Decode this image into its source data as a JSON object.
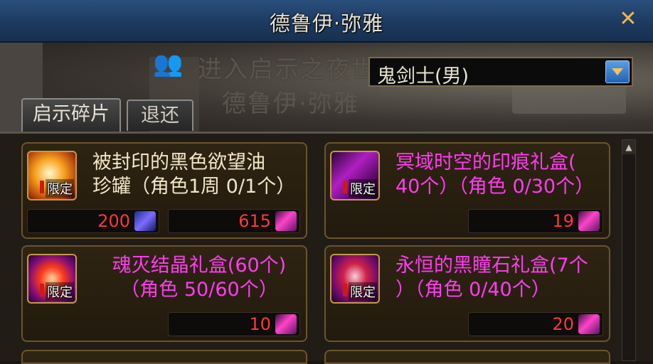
{
  "window": {
    "title": "德鲁伊·弥雅"
  },
  "banner": {
    "title": "进入启示之夜世界",
    "subtitle": "德鲁伊·弥雅"
  },
  "class_select": {
    "value": "鬼剑士(男)"
  },
  "tabs": [
    {
      "label": "启示碎片",
      "active": true
    },
    {
      "label": "退还",
      "active": false
    }
  ],
  "items": [
    {
      "name": "被封印的黑色欲望油珍罐（角色1周 0/1个）",
      "name_lines": [
        "被封印的黑色欲望油",
        "珍罐（角色1周 0/1个）"
      ],
      "color": "#f1e6c8",
      "badge": "限定",
      "prices": [
        {
          "value": "200",
          "currency": "blue-crystal-icon"
        },
        {
          "value": "615",
          "currency": "pink-crystal-icon"
        }
      ]
    },
    {
      "name": "冥域时空的印痕礼盒(40个)（角色 0/30个）",
      "name_lines": [
        "冥域时空的印痕礼盒(",
        "40个）（角色 0/30个）"
      ],
      "color": "#ff3cf0",
      "badge": "限定",
      "prices": [
        {
          "value": "19",
          "currency": "pink-crystal-icon"
        }
      ]
    },
    {
      "name": "魂灭结晶礼盒(60个)（角色 50/60个）",
      "name_lines": [
        "魂灭结晶礼盒(60个)",
        "（角色 50/60个）"
      ],
      "color": "#ff3cf0",
      "badge": "限定",
      "prices": [
        {
          "value": "10",
          "currency": "pink-crystal-icon"
        }
      ]
    },
    {
      "name": "永恒的黑瞳石礼盒(7个)（角色 0/40个）",
      "name_lines": [
        "永恒的黑瞳石礼盒(7个",
        "）（角色 0/40个）"
      ],
      "color": "#ff3cf0",
      "badge": "限定",
      "prices": [
        {
          "value": "20",
          "currency": "pink-crystal-icon"
        }
      ]
    }
  ]
}
